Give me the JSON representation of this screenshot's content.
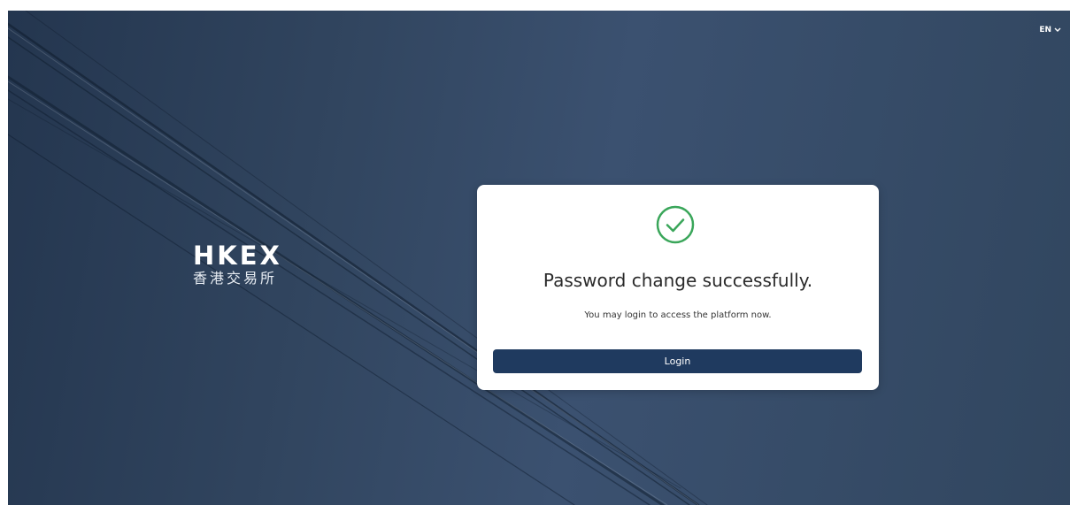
{
  "header": {
    "language_label": "EN"
  },
  "brand": {
    "logo_text": "HKEX",
    "logo_chinese": "香港交易所"
  },
  "dialog": {
    "status_icon": "check-circle-icon",
    "title": "Password change successfully.",
    "message": "You may login to access the platform now.",
    "login_button_label": "Login"
  },
  "colors": {
    "accent_green": "#3aa65a",
    "button_navy": "#1f3a5f"
  }
}
